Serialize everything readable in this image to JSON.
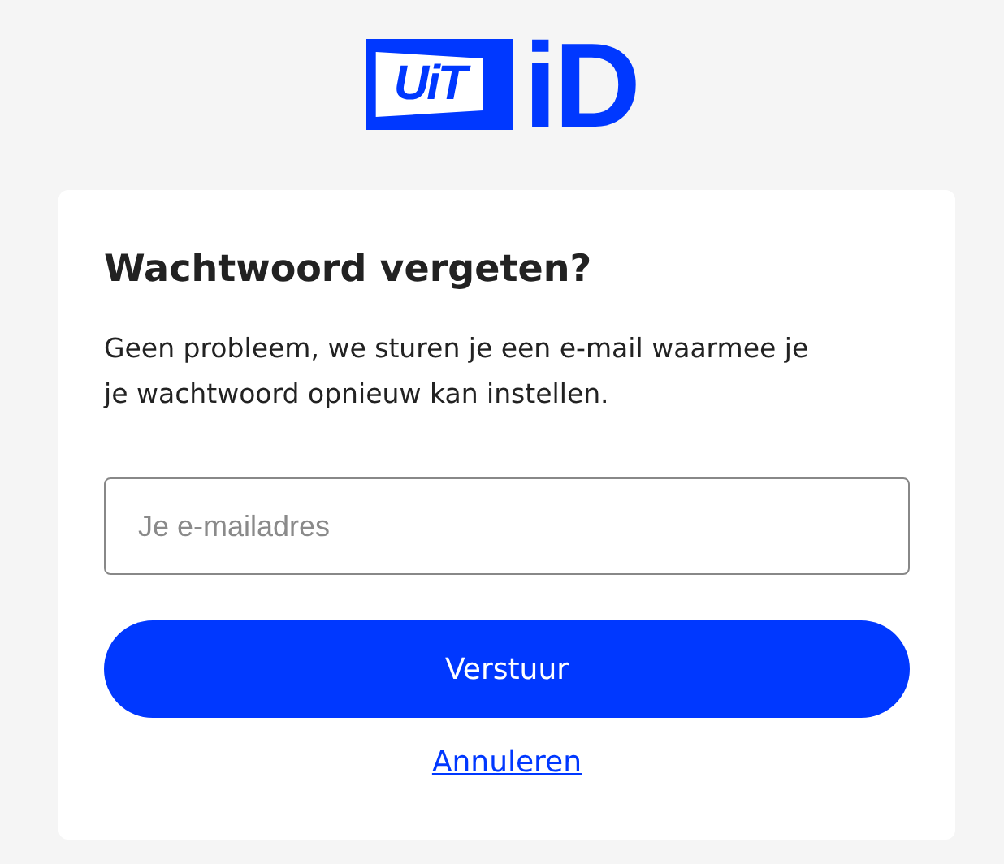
{
  "logo": {
    "badge": "UiT",
    "word": "iD"
  },
  "card": {
    "title": "Wachtwoord vergeten?",
    "text": "Geen probleem, we sturen je een e-mail waarmee je je wachtwoord opnieuw kan instellen.",
    "email": {
      "placeholder": "Je e-mailadres"
    },
    "submit": "Verstuur",
    "cancel": "Annuleren"
  }
}
